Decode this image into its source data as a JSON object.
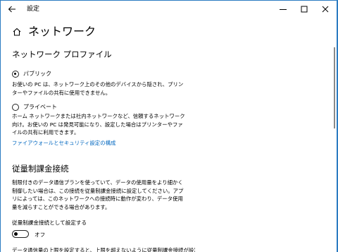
{
  "window": {
    "app_title": "設定",
    "accent_color": "#2b7bc1"
  },
  "page": {
    "title": "ネットワーク",
    "home_icon": "home-icon"
  },
  "network_profile": {
    "heading": "ネットワーク プロファイル",
    "options": [
      {
        "label": "パブリック",
        "checked": true,
        "description": "お使いの PC は、ネットワーク上のその他のデバイスから隠され、プリンターやファイルの共有に使用できません。"
      },
      {
        "label": "プライベート",
        "checked": false,
        "description": "ホーム ネットワークまたは社内ネットワークなど、信頼するネットワーク向け。お使いの PC は発見可能になり、設定した場合はプリンターやファイルの共有に利用できます。"
      }
    ],
    "firewall_link": "ファイアウォールとセキュリティ設定の構成"
  },
  "metered": {
    "heading": "従量制課金接続",
    "description": "制限付きのデータ通信プランを使っていて、データの使用量をより細かく制御したい場合は、この接続を従量制課金接続に設定してください。アプリによっては、このネットワークへの接続時に動作が変わり、データ使用量を減らすことができる場合があります。",
    "toggle_label": "従量制課金接続として設定する",
    "toggle_state": "オフ",
    "toggle_on": false,
    "footer_text": "データ通信量の上限を設定すると、上限を超えないように従量制課金接続が設定"
  }
}
